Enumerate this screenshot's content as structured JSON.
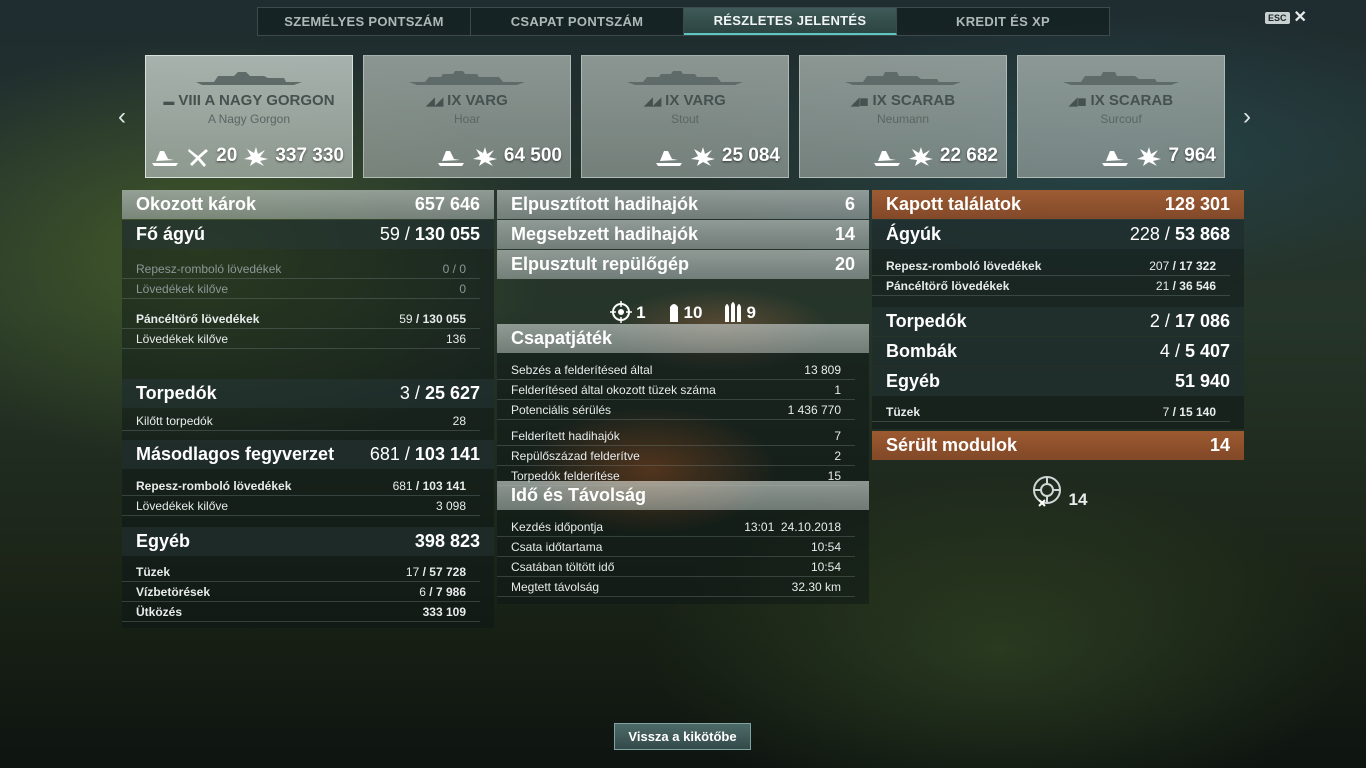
{
  "tabs": [
    {
      "label": "SZEMÉLYES PONTSZÁM"
    },
    {
      "label": "CSAPAT PONTSZÁM"
    },
    {
      "label": "RÉSZLETES JELENTÉS"
    },
    {
      "label": "KREDIT ÉS XP"
    }
  ],
  "esc": {
    "key": "ESC",
    "close": "✕"
  },
  "ships": [
    {
      "tier_name": "VIII A NAGY GORGON",
      "captain": "A Nagy Gorgon",
      "stat1": "20",
      "stat2": "337 330"
    },
    {
      "tier_name": "IX VARG",
      "captain": "Hoar",
      "stat2": "64 500"
    },
    {
      "tier_name": "IX VARG",
      "captain": "Stout",
      "stat2": "25 084"
    },
    {
      "tier_name": "IX SCARAB",
      "captain": "Neumann",
      "stat2": "22 682"
    },
    {
      "tier_name": "IX SCARAB",
      "captain": "Surcouf",
      "stat2": "7 964"
    }
  ],
  "left": {
    "damage": {
      "label": "Okozott károk",
      "value": "657 646"
    },
    "main": {
      "label": "Fő ágyú",
      "hits": "59",
      "total": "130 055"
    },
    "he": {
      "label": "Repesz-romboló lövedékek",
      "value": "0 / 0"
    },
    "he_fired": {
      "label": "Lövedékek kilőve",
      "value": "0"
    },
    "ap": {
      "label": "Páncéltörő lövedékek",
      "hits": "59",
      "total": "130 055"
    },
    "ap_fired": {
      "label": "Lövedékek kilőve",
      "value": "136"
    },
    "torp": {
      "label": "Torpedók",
      "hits": "3",
      "total": "25 627"
    },
    "torp_fired": {
      "label": "Kilőtt torpedók",
      "value": "28"
    },
    "secondary": {
      "label": "Másodlagos fegyverzet",
      "hits": "681",
      "total": "103 141"
    },
    "sec_he": {
      "label": "Repesz-romboló lövedékek",
      "hits": "681",
      "total": "103 141"
    },
    "sec_fired": {
      "label": "Lövedékek kilőve",
      "value": "3 098"
    },
    "other": {
      "label": "Egyéb",
      "value": "398 823"
    },
    "fires": {
      "label": "Tüzek",
      "hits": "17",
      "total": "57 728"
    },
    "flood": {
      "label": "Vízbetörések",
      "hits": "6",
      "total": "7 986"
    },
    "ram": {
      "label": "Ütközés",
      "value": "333 109"
    }
  },
  "middle": {
    "destroyed": {
      "label": "Elpusztított hadihajók",
      "value": "6"
    },
    "damaged": {
      "label": "Megsebzett hadihajók",
      "value": "14"
    },
    "planes": {
      "label": "Elpusztult repülőgép",
      "value": "20"
    },
    "badges": {
      "citadel": "1",
      "torpedo": "10",
      "shells": "9"
    },
    "team": {
      "label": "Csapatjáték"
    },
    "spot_dmg": {
      "label": "Sebzés a felderítésed által",
      "value": "13 809"
    },
    "spot_fires": {
      "label": "Felderítésed által okozott tüzek száma",
      "value": "1"
    },
    "potential": {
      "label": "Potenciális sérülés",
      "value": "1 436 770"
    },
    "spotted": {
      "label": "Felderített hadihajók",
      "value": "7"
    },
    "squadrons": {
      "label": "Repülőszázad felderítve",
      "value": "2"
    },
    "torps_spotted": {
      "label": "Torpedók felderítése",
      "value": "15"
    },
    "time": {
      "label": "Idő és Távolság"
    },
    "start": {
      "label": "Kezdés időpontja",
      "value": "13:01  24.10.2018"
    },
    "duration": {
      "label": "Csata időtartama",
      "value": "10:54"
    },
    "in_battle": {
      "label": "Csatában töltött idő",
      "value": "10:54"
    },
    "distance": {
      "label": "Megtett távolság",
      "value": "32.30 km"
    }
  },
  "right": {
    "received": {
      "label": "Kapott találatok",
      "value": "128 301"
    },
    "guns": {
      "label": "Ágyúk",
      "hits": "228",
      "total": "53 868"
    },
    "he": {
      "label": "Repesz-romboló lövedékek",
      "hits": "207",
      "total": "17 322"
    },
    "ap": {
      "label": "Páncéltörő lövedékek",
      "hits": "21",
      "total": "36 546"
    },
    "torp": {
      "label": "Torpedók",
      "hits": "2",
      "total": "17 086"
    },
    "bombs": {
      "label": "Bombák",
      "hits": "4",
      "total": "5 407"
    },
    "other": {
      "label": "Egyéb",
      "value": "51 940"
    },
    "fires": {
      "label": "Tüzek",
      "hits": "7",
      "total": "15 140"
    },
    "modules": {
      "label": "Sérült modulok",
      "value": "14"
    },
    "modules_badge": "14"
  },
  "back_button": "Vissza a kikötőbe"
}
